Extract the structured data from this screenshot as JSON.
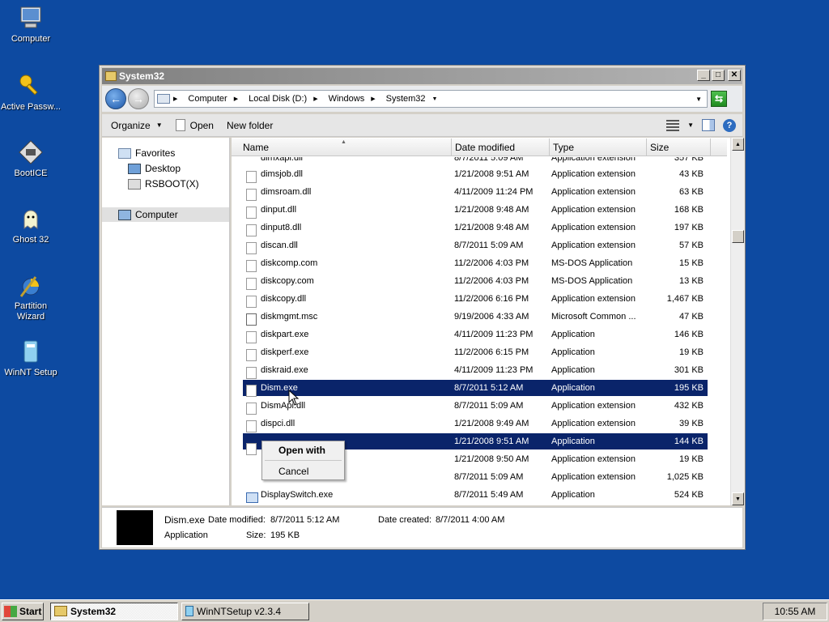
{
  "desktop": {
    "icons": [
      {
        "label": "Computer",
        "icon": "computer-icon"
      },
      {
        "label": "Active Passw...",
        "icon": "key-icon"
      },
      {
        "label": "BootICE",
        "icon": "bootice-icon"
      },
      {
        "label": "Ghost 32",
        "icon": "ghost-icon"
      },
      {
        "label": "Partition Wizard",
        "icon": "partition-wizard-icon"
      },
      {
        "label": "WinNT Setup",
        "icon": "winnt-setup-icon"
      }
    ]
  },
  "window": {
    "title": "System32",
    "buttons": {
      "minimize": "_",
      "maximize": "□",
      "close": "✕"
    }
  },
  "address": {
    "crumbs": [
      "Computer",
      "Local Disk (D:)",
      "Windows",
      "System32"
    ]
  },
  "toolbar": {
    "organize": "Organize",
    "open": "Open",
    "new_folder": "New folder"
  },
  "navpane": {
    "favorites": "Favorites",
    "desktop": "Desktop",
    "rsboot": "RSBOOT(X)",
    "computer": "Computer"
  },
  "columns": {
    "name": "Name",
    "date": "Date modified",
    "type": "Type",
    "size": "Size"
  },
  "files": [
    {
      "name": "dimsjob.dll",
      "date": "1/21/2008 9:51 AM",
      "type": "Application extension",
      "size": "43 KB"
    },
    {
      "name": "dimsroam.dll",
      "date": "4/11/2009 11:24 PM",
      "type": "Application extension",
      "size": "63 KB"
    },
    {
      "name": "dinput.dll",
      "date": "1/21/2008 9:48 AM",
      "type": "Application extension",
      "size": "168 KB"
    },
    {
      "name": "dinput8.dll",
      "date": "1/21/2008 9:48 AM",
      "type": "Application extension",
      "size": "197 KB"
    },
    {
      "name": "discan.dll",
      "date": "8/7/2011 5:09 AM",
      "type": "Application extension",
      "size": "57 KB"
    },
    {
      "name": "diskcomp.com",
      "date": "11/2/2006 4:03 PM",
      "type": "MS-DOS Application",
      "size": "15 KB"
    },
    {
      "name": "diskcopy.com",
      "date": "11/2/2006 4:03 PM",
      "type": "MS-DOS Application",
      "size": "13 KB"
    },
    {
      "name": "diskcopy.dll",
      "date": "11/2/2006 6:16 PM",
      "type": "Application extension",
      "size": "1,467 KB"
    },
    {
      "name": "diskmgmt.msc",
      "date": "9/19/2006 4:33 AM",
      "type": "Microsoft Common ...",
      "size": "47 KB"
    },
    {
      "name": "diskpart.exe",
      "date": "4/11/2009 11:23 PM",
      "type": "Application",
      "size": "146 KB"
    },
    {
      "name": "diskperf.exe",
      "date": "11/2/2006 6:15 PM",
      "type": "Application",
      "size": "19 KB"
    },
    {
      "name": "diskraid.exe",
      "date": "4/11/2009 11:23 PM",
      "type": "Application",
      "size": "301 KB"
    },
    {
      "name": "Dism.exe",
      "date": "8/7/2011 5:12 AM",
      "type": "Application",
      "size": "195 KB"
    },
    {
      "name": "DismApi.dll",
      "date": "8/7/2011 5:09 AM",
      "type": "Application extension",
      "size": "432 KB"
    },
    {
      "name": "dispci.dll",
      "date": "1/21/2008 9:49 AM",
      "type": "Application extension",
      "size": "39 KB"
    },
    {
      "name": "",
      "date": "1/21/2008 9:51 AM",
      "type": "Application",
      "size": "144 KB"
    },
    {
      "name": "",
      "date": "1/21/2008 9:50 AM",
      "type": "Application extension",
      "size": "19 KB"
    },
    {
      "name": "",
      "date": "8/7/2011 5:09 AM",
      "type": "Application extension",
      "size": "1,025 KB"
    },
    {
      "name": "DisplaySwitch.exe",
      "date": "8/7/2011 5:49 AM",
      "type": "Application",
      "size": "524 KB"
    }
  ],
  "context_menu": {
    "open_with": "Open with",
    "cancel": "Cancel"
  },
  "details": {
    "name": "Dism.exe",
    "modified_label": "Date modified:",
    "modified": "8/7/2011 5:12 AM",
    "created_label": "Date created:",
    "created": "8/7/2011 4:00 AM",
    "type": "Application",
    "size_label": "Size:",
    "size": "195 KB"
  },
  "taskbar": {
    "start": "Start",
    "tasks": [
      "System32",
      "WinNTSetup v2.3.4"
    ],
    "clock": "10:55 AM"
  }
}
